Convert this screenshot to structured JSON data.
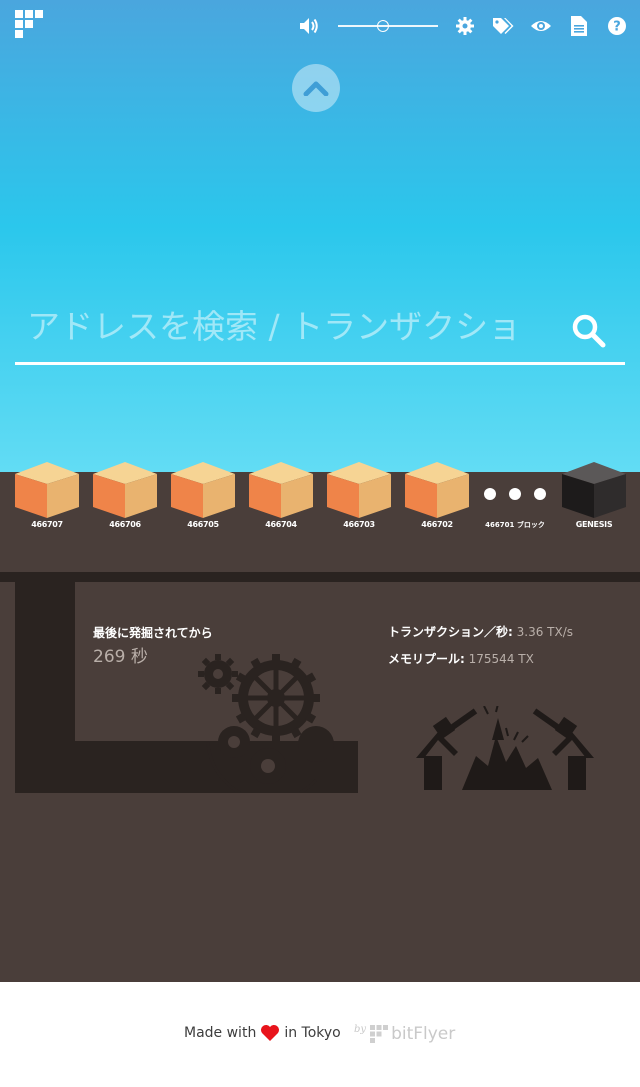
{
  "header": {
    "logo_icon": "grid-logo-icon",
    "icons": [
      "volume-icon",
      "gear-icon",
      "tags-icon",
      "eye-icon",
      "document-icon",
      "help-icon"
    ],
    "volume_level": 0.45
  },
  "search": {
    "placeholder": "アドレスを検索 / トランザクショ"
  },
  "blocks": [
    {
      "label": "466707"
    },
    {
      "label": "466706"
    },
    {
      "label": "466705"
    },
    {
      "label": "466704"
    },
    {
      "label": "466703"
    },
    {
      "label": "466702"
    }
  ],
  "more_blocks": {
    "label": "466701 ブロック"
  },
  "genesis": {
    "label": "GENESIS"
  },
  "mine": {
    "since_label": "最後に発掘されてから",
    "since_value": "269 秒",
    "tps_label": "トランザクション／秒:",
    "tps_value": "3.36 TX/s",
    "mempool_label": "メモリプール:",
    "mempool_value": "175544 TX"
  },
  "footer": {
    "made_with": "Made with",
    "in_tokyo": "in Tokyo",
    "by": "by",
    "brand": "bitFlyer"
  },
  "colors": {
    "sky_top": "#4aa6de",
    "sky_bottom": "#62dcf4",
    "ground": "#4a3e3a",
    "dark_pipe": "#2a2320",
    "block_front": "#ef8449",
    "block_side": "#e9b36f",
    "block_top": "#f6d494",
    "heart": "#e8141c"
  }
}
